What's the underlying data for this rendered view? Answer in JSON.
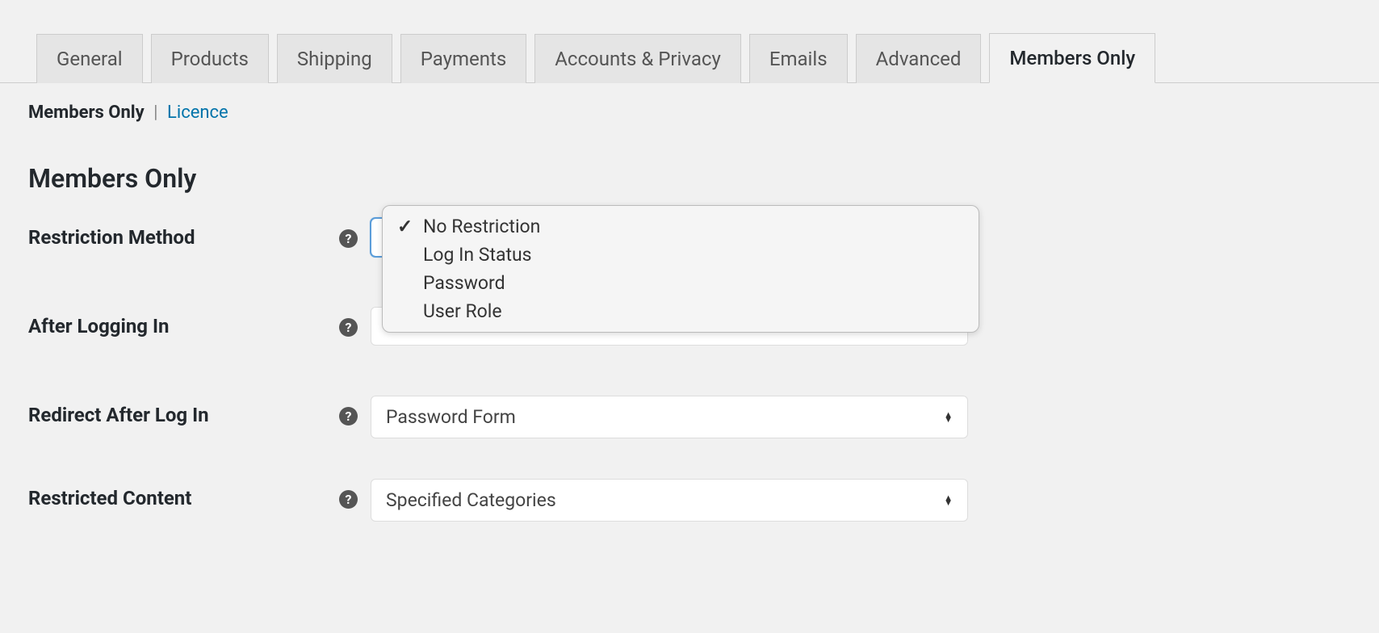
{
  "tabs": [
    {
      "label": "General",
      "active": false
    },
    {
      "label": "Products",
      "active": false
    },
    {
      "label": "Shipping",
      "active": false
    },
    {
      "label": "Payments",
      "active": false
    },
    {
      "label": "Accounts & Privacy",
      "active": false
    },
    {
      "label": "Emails",
      "active": false
    },
    {
      "label": "Advanced",
      "active": false
    },
    {
      "label": "Members Only",
      "active": true
    }
  ],
  "subnav": {
    "current": "Members Only",
    "separator": "|",
    "link": "Licence"
  },
  "heading": "Members Only",
  "fields": {
    "restriction_method": {
      "label": "Restriction Method",
      "options": [
        "No Restriction",
        "Log In Status",
        "Password",
        "User Role"
      ],
      "selected": "No Restriction"
    },
    "after_logging_in": {
      "label": "After Logging In",
      "value": ""
    },
    "redirect_after_login": {
      "label": "Redirect After Log In",
      "value": "Password Form"
    },
    "restricted_content": {
      "label": "Restricted Content",
      "value": "Specified Categories"
    }
  },
  "help_char": "?"
}
